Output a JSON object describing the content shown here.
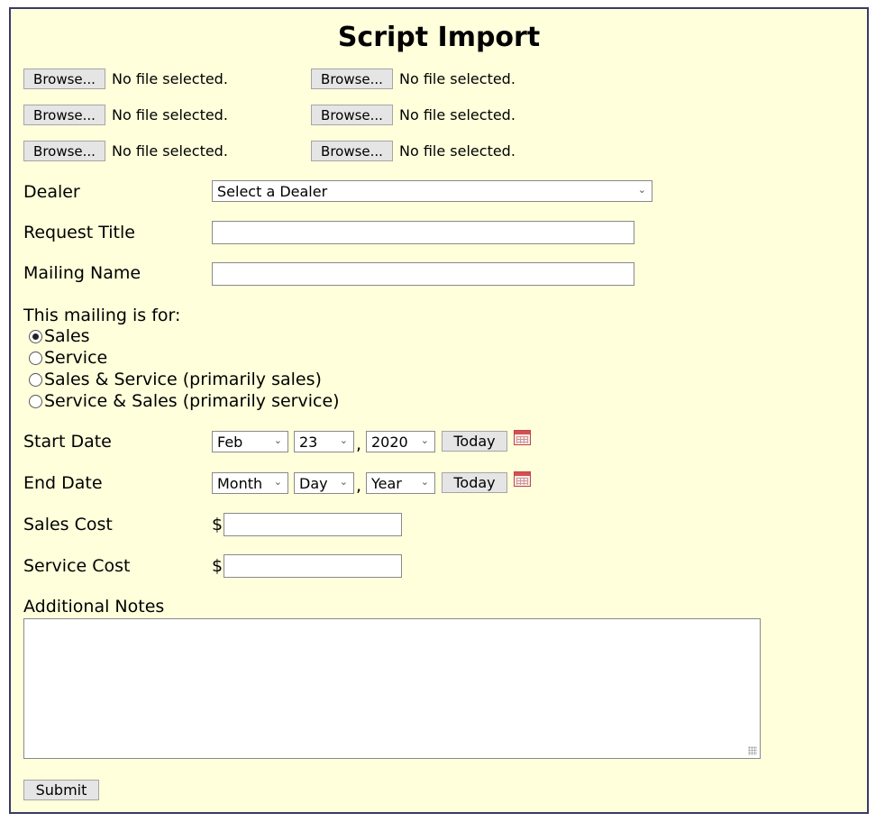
{
  "form": {
    "title": "Script Import",
    "file_inputs": [
      {
        "button": "Browse...",
        "status": "No file selected."
      },
      {
        "button": "Browse...",
        "status": "No file selected."
      },
      {
        "button": "Browse...",
        "status": "No file selected."
      },
      {
        "button": "Browse...",
        "status": "No file selected."
      },
      {
        "button": "Browse...",
        "status": "No file selected."
      },
      {
        "button": "Browse...",
        "status": "No file selected."
      }
    ],
    "dealer": {
      "label": "Dealer",
      "selected": "Select a Dealer"
    },
    "request_title": {
      "label": "Request Title",
      "value": ""
    },
    "mailing_name": {
      "label": "Mailing Name",
      "value": ""
    },
    "mailing_for": {
      "label": "This mailing is for:",
      "options": [
        {
          "label": "Sales",
          "checked": true
        },
        {
          "label": "Service",
          "checked": false
        },
        {
          "label": "Sales & Service (primarily sales)",
          "checked": false
        },
        {
          "label": "Service & Sales (primarily service)",
          "checked": false
        }
      ]
    },
    "start_date": {
      "label": "Start Date",
      "month": "Feb",
      "day": "23",
      "year": "2020",
      "today_button": "Today"
    },
    "end_date": {
      "label": "End Date",
      "month": "Month",
      "day": "Day",
      "year": "Year",
      "today_button": "Today"
    },
    "sales_cost": {
      "label": "Sales Cost",
      "currency": "$",
      "value": ""
    },
    "service_cost": {
      "label": "Service Cost",
      "currency": "$",
      "value": ""
    },
    "additional_notes": {
      "label": "Additional Notes",
      "value": ""
    },
    "submit_label": "Submit"
  },
  "icons": {
    "calendar": "calendar-icon",
    "dropdown": "chevron-down-icon"
  },
  "colors": {
    "panel_background": "#ffffdc",
    "panel_border": "#3a3a6a",
    "button_background": "#e5e5e5"
  }
}
